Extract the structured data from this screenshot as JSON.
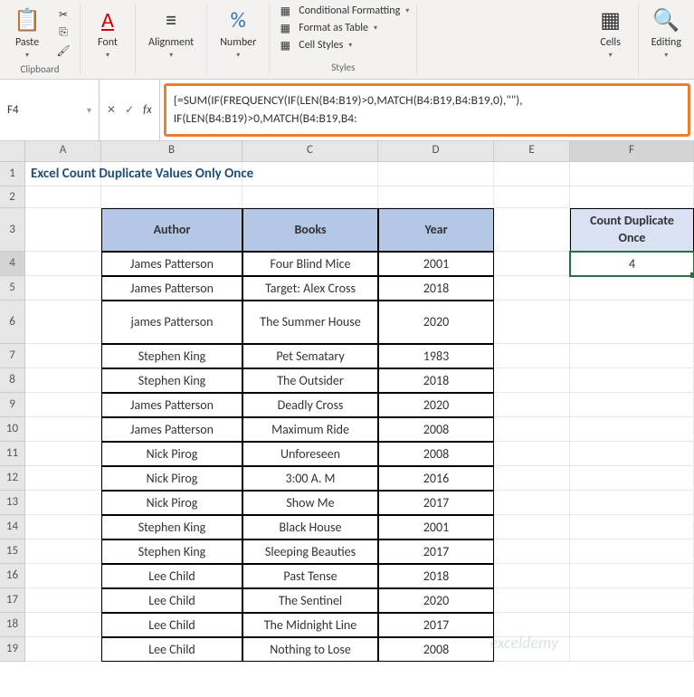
{
  "ribbon": {
    "clipboard": {
      "label": "Clipboard",
      "paste": "Paste"
    },
    "font": {
      "label": "Font"
    },
    "alignment": {
      "label": "Alignment"
    },
    "number": {
      "label": "Number"
    },
    "styles": {
      "label": "Styles",
      "conditional": "Conditional Formatting",
      "table": "Format as Table",
      "cell": "Cell Styles"
    },
    "cells": {
      "label": "Cells"
    },
    "editing": {
      "label": "Editing"
    }
  },
  "formula_bar": {
    "cell_ref": "F4",
    "fx": "fx",
    "formula": "{=SUM(IF(FREQUENCY(IF(LEN(B4:B19)>0,MATCH(B4:B19,B4:B19,0),\"\"), IF(LEN(B4:B19)>0,MATCH(B4:B19,B4:"
  },
  "columns": [
    "A",
    "B",
    "C",
    "D",
    "E",
    "F"
  ],
  "title": "Excel Count Duplicate Values Only Once",
  "table_headers": {
    "author": "Author",
    "books": "Books",
    "year": "Year"
  },
  "count_header": "Count Duplicate Once",
  "count_value": "4",
  "rows": [
    {
      "n": 4,
      "author": "James Patterson",
      "book": "Four Blind Mice",
      "year": "2001"
    },
    {
      "n": 5,
      "author": "James Patterson",
      "book": "Target: Alex Cross",
      "year": "2018"
    },
    {
      "n": 6,
      "author": "james Patterson",
      "book": "The Summer House",
      "year": "2020",
      "tall": true
    },
    {
      "n": 7,
      "author": "Stephen King",
      "book": "Pet Sematary",
      "year": "1983"
    },
    {
      "n": 8,
      "author": "Stephen King",
      "book": "The Outsider",
      "year": "2018"
    },
    {
      "n": 9,
      "author": "James Patterson",
      "book": "Deadly Cross",
      "year": "2020"
    },
    {
      "n": 10,
      "author": "James Patterson",
      "book": "Maximum Ride",
      "year": "2008"
    },
    {
      "n": 11,
      "author": "Nick Pirog",
      "book": "Unforeseen",
      "year": "2008"
    },
    {
      "n": 12,
      "author": "Nick Pirog",
      "book": "3:00 A. M",
      "year": "2016"
    },
    {
      "n": 13,
      "author": "Nick Pirog",
      "book": "Show Me",
      "year": "2017"
    },
    {
      "n": 14,
      "author": "Stephen King",
      "book": "Black House",
      "year": "2001"
    },
    {
      "n": 15,
      "author": "Stephen King",
      "book": "Sleeping Beauties",
      "year": "2017"
    },
    {
      "n": 16,
      "author": "Lee Child",
      "book": "Past Tense",
      "year": "2018"
    },
    {
      "n": 17,
      "author": "Lee Child",
      "book": "The Sentinel",
      "year": "2020"
    },
    {
      "n": 18,
      "author": "Lee Child",
      "book": "The Midnight Line",
      "year": "2017"
    },
    {
      "n": 19,
      "author": "Lee Child",
      "book": "Nothing to Lose",
      "year": "2008"
    }
  ],
  "watermark": "exceldemy"
}
